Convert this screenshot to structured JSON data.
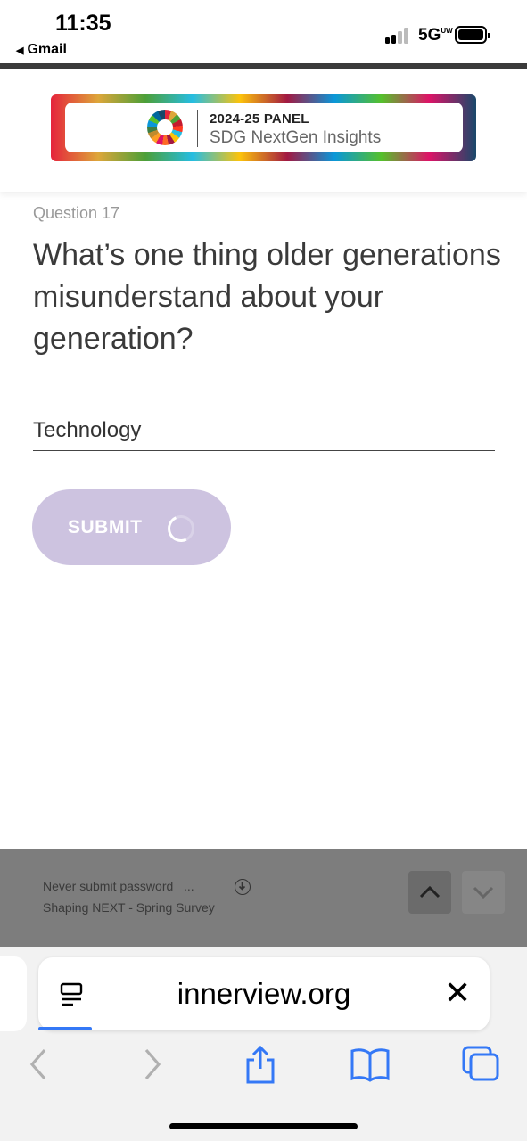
{
  "status_bar": {
    "time": "11:35",
    "back_label": "Gmail",
    "network": "5G",
    "network_suffix": "UW"
  },
  "header": {
    "banner_title_year": "2024-25",
    "banner_title_panel": "PANEL",
    "banner_subtitle": "SDG NextGen Insights"
  },
  "question": {
    "number_label": "Question 17",
    "text": "What’s one thing older generations misunderstand about your generation?",
    "answer_value": "Technology"
  },
  "submit": {
    "label": "SUBMIT"
  },
  "overlay": {
    "line1": "Never submit password",
    "line1_ellipsis": "...",
    "line2": "Shaping NEXT - Spring Survey"
  },
  "safari": {
    "url": "innerview.org"
  },
  "colors": {
    "accent": "#3478f6",
    "submit_bg": "#cdc3e0",
    "overlay_bg": "#7d7d7d"
  }
}
